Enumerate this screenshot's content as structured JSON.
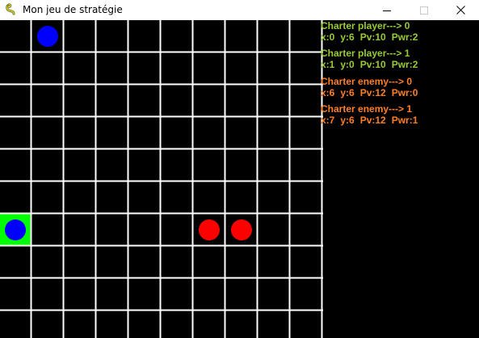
{
  "window": {
    "title": "Mon jeu de stratégie",
    "icon": "pygame-snake-icon",
    "controls": [
      "minimize",
      "maximize",
      "close"
    ]
  },
  "board": {
    "cols": 10,
    "rows": 10,
    "grid_line_color": "#ffffff",
    "cell_color": "#000000",
    "highlight_color": "#00ff00",
    "highlighted_cell": {
      "x": 0,
      "y": 6
    },
    "player_color": "#0000ff",
    "enemy_color": "#ff0000"
  },
  "units": [
    {
      "side": "player",
      "x": 0,
      "y": 6
    },
    {
      "side": "player",
      "x": 1,
      "y": 0
    },
    {
      "side": "enemy",
      "x": 6,
      "y": 6
    },
    {
      "side": "enemy",
      "x": 7,
      "y": 6
    }
  ],
  "info_panel": {
    "player_text_color": "#99cc33",
    "enemy_text_color": "#ff7f27",
    "charters": [
      {
        "side": "player",
        "header": "Charter player---> 0",
        "x": "x:0",
        "y": "y:6",
        "pv": "Pv:10",
        "pwr": "Pwr:2"
      },
      {
        "side": "player",
        "header": "Charter player---> 1",
        "x": "x:1",
        "y": "y:0",
        "pv": "Pv:10",
        "pwr": "Pwr:2"
      },
      {
        "side": "enemy",
        "header": "Charter enemy---> 0",
        "x": "x:6",
        "y": "y:6",
        "pv": "Pv:12",
        "pwr": "Pwr:0"
      },
      {
        "side": "enemy",
        "header": "Charter enemy---> 1",
        "x": "x:7",
        "y": "y:6",
        "pv": "Pv:12",
        "pwr": "Pwr:1"
      }
    ]
  }
}
